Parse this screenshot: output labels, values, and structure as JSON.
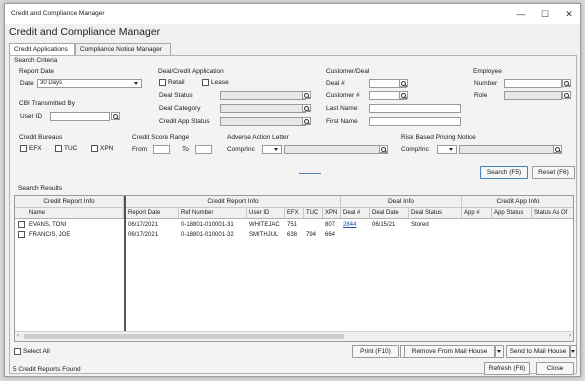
{
  "window": {
    "title": "Credit and Compliance Manager",
    "minimize": "—",
    "maximize": "☐",
    "close": "✕"
  },
  "app_title": "Credit and Compliance Manager",
  "tabs": [
    {
      "label": "Credit Applications",
      "active": true
    },
    {
      "label": "Compliance Notice Manager",
      "active": false
    }
  ],
  "search_criteria": {
    "title": "Search Criteria",
    "report_date": {
      "label": "Report Date",
      "date_label": "Date",
      "value": "30 Days"
    },
    "cbi": {
      "label": "CBI Transmitted By",
      "user_id_label": "User ID",
      "user_id_value": ""
    },
    "deal_credit_app": {
      "label": "Deal/Credit Application",
      "retail": "Retail",
      "lease": "Lease",
      "deal_status": "Deal Status",
      "deal_category": "Deal Category",
      "credit_app_status": "Credit App Status"
    },
    "customer_deal": {
      "label": "Customer/Deal",
      "deal_no": "Deal #",
      "customer_no": "Customer #",
      "last_name": "Last Name",
      "first_name": "First Name"
    },
    "employee": {
      "label": "Employee",
      "number": "Number",
      "role": "Role"
    },
    "credit_bureaus": {
      "label": "Credit Bureaus",
      "efx": "EFX",
      "tuc": "TUC",
      "xpn": "XPN"
    },
    "score_range": {
      "label": "Credit Score Range",
      "from": "From",
      "to": "To"
    },
    "adverse_action": {
      "label": "Adverse Action Letter",
      "comp_inc": "Comp/Inc"
    },
    "risk_based": {
      "label": "Risk Based Pricing Notice",
      "comp_inc": "Comp/Inc"
    },
    "search_button": "Search (F5)",
    "reset_button": "Reset (F6)"
  },
  "results": {
    "title": "Search Results",
    "group_headers": [
      "Credit Report Info",
      "Credit Report Info",
      "Deal Info",
      "Credit App Info"
    ],
    "columns": [
      "Name",
      "Report Date",
      "Ref Number",
      "User ID",
      "EFX",
      "TUC",
      "XPN",
      "Deal #",
      "Deal Date",
      "Deal Status",
      "App #",
      "App Status",
      "Status As Of"
    ],
    "rows": [
      [
        "EVANS, TONI",
        "06/17/2021",
        "0-18801-010001-31",
        "WHITEJAC",
        "751",
        "",
        "807",
        "2844",
        "06/15/21",
        "Stored",
        "",
        "",
        ""
      ],
      [
        "FRANCIS, JOE",
        "06/17/2021",
        "0-18801-010001-32",
        "SMITHJUL",
        "638",
        "794",
        "664",
        "",
        "",
        "",
        "",
        "",
        ""
      ]
    ]
  },
  "footer": {
    "select_all": "Select All",
    "print_button": "Print (F10)",
    "remove_button": "Remove From Mail House",
    "send_button": "Send to Mail House",
    "status": "5 Credit Reports Found",
    "refresh_button": "Refresh (F8)",
    "close_button": "Close"
  }
}
